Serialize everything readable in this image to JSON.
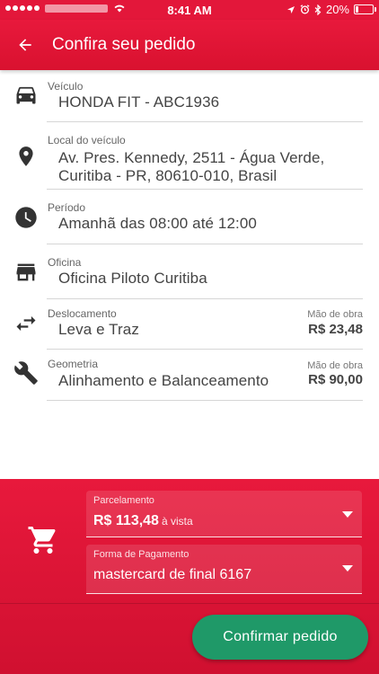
{
  "status_bar": {
    "time": "8:41 AM",
    "battery": "20%",
    "battery_fraction": 0.2
  },
  "header": {
    "title": "Confira seu pedido"
  },
  "items": [
    {
      "label": "Veículo",
      "value": "HONDA FIT - ABC1936",
      "icon": "car-icon"
    },
    {
      "label": "Local do veículo",
      "value_line1": "Av. Pres. Kennedy, 2511 - Água Verde,",
      "value_line2": "Curitiba - PR, 80610-010, Brasil",
      "icon": "location-pin-icon"
    },
    {
      "label": "Período",
      "value": "Amanhã das 08:00 até 12:00",
      "icon": "clock-icon"
    },
    {
      "label": "Oficina",
      "value": "Oficina Piloto Curitiba",
      "icon": "store-icon"
    },
    {
      "label": "Deslocamento",
      "value": "Leva e Traz",
      "price_label": "Mão de obra",
      "price": "R$ 23,48",
      "icon": "swap-arrows-icon"
    },
    {
      "label": "Geometria",
      "value": "Alinhamento e Balanceamento",
      "price_label": "Mão de obra",
      "price": "R$ 90,00",
      "icon": "wrench-icon"
    }
  ],
  "payment": {
    "installments_label": "Parcelamento",
    "installments_value": "R$ 113,48",
    "installments_suffix": "à vista",
    "method_label": "Forma de Pagamento",
    "method_value": "mastercard de final 6167"
  },
  "confirm_label": "Confirmar pedido",
  "colors": {
    "primary": "#e3173a",
    "confirm": "#1f9968",
    "icon": "#333333"
  }
}
